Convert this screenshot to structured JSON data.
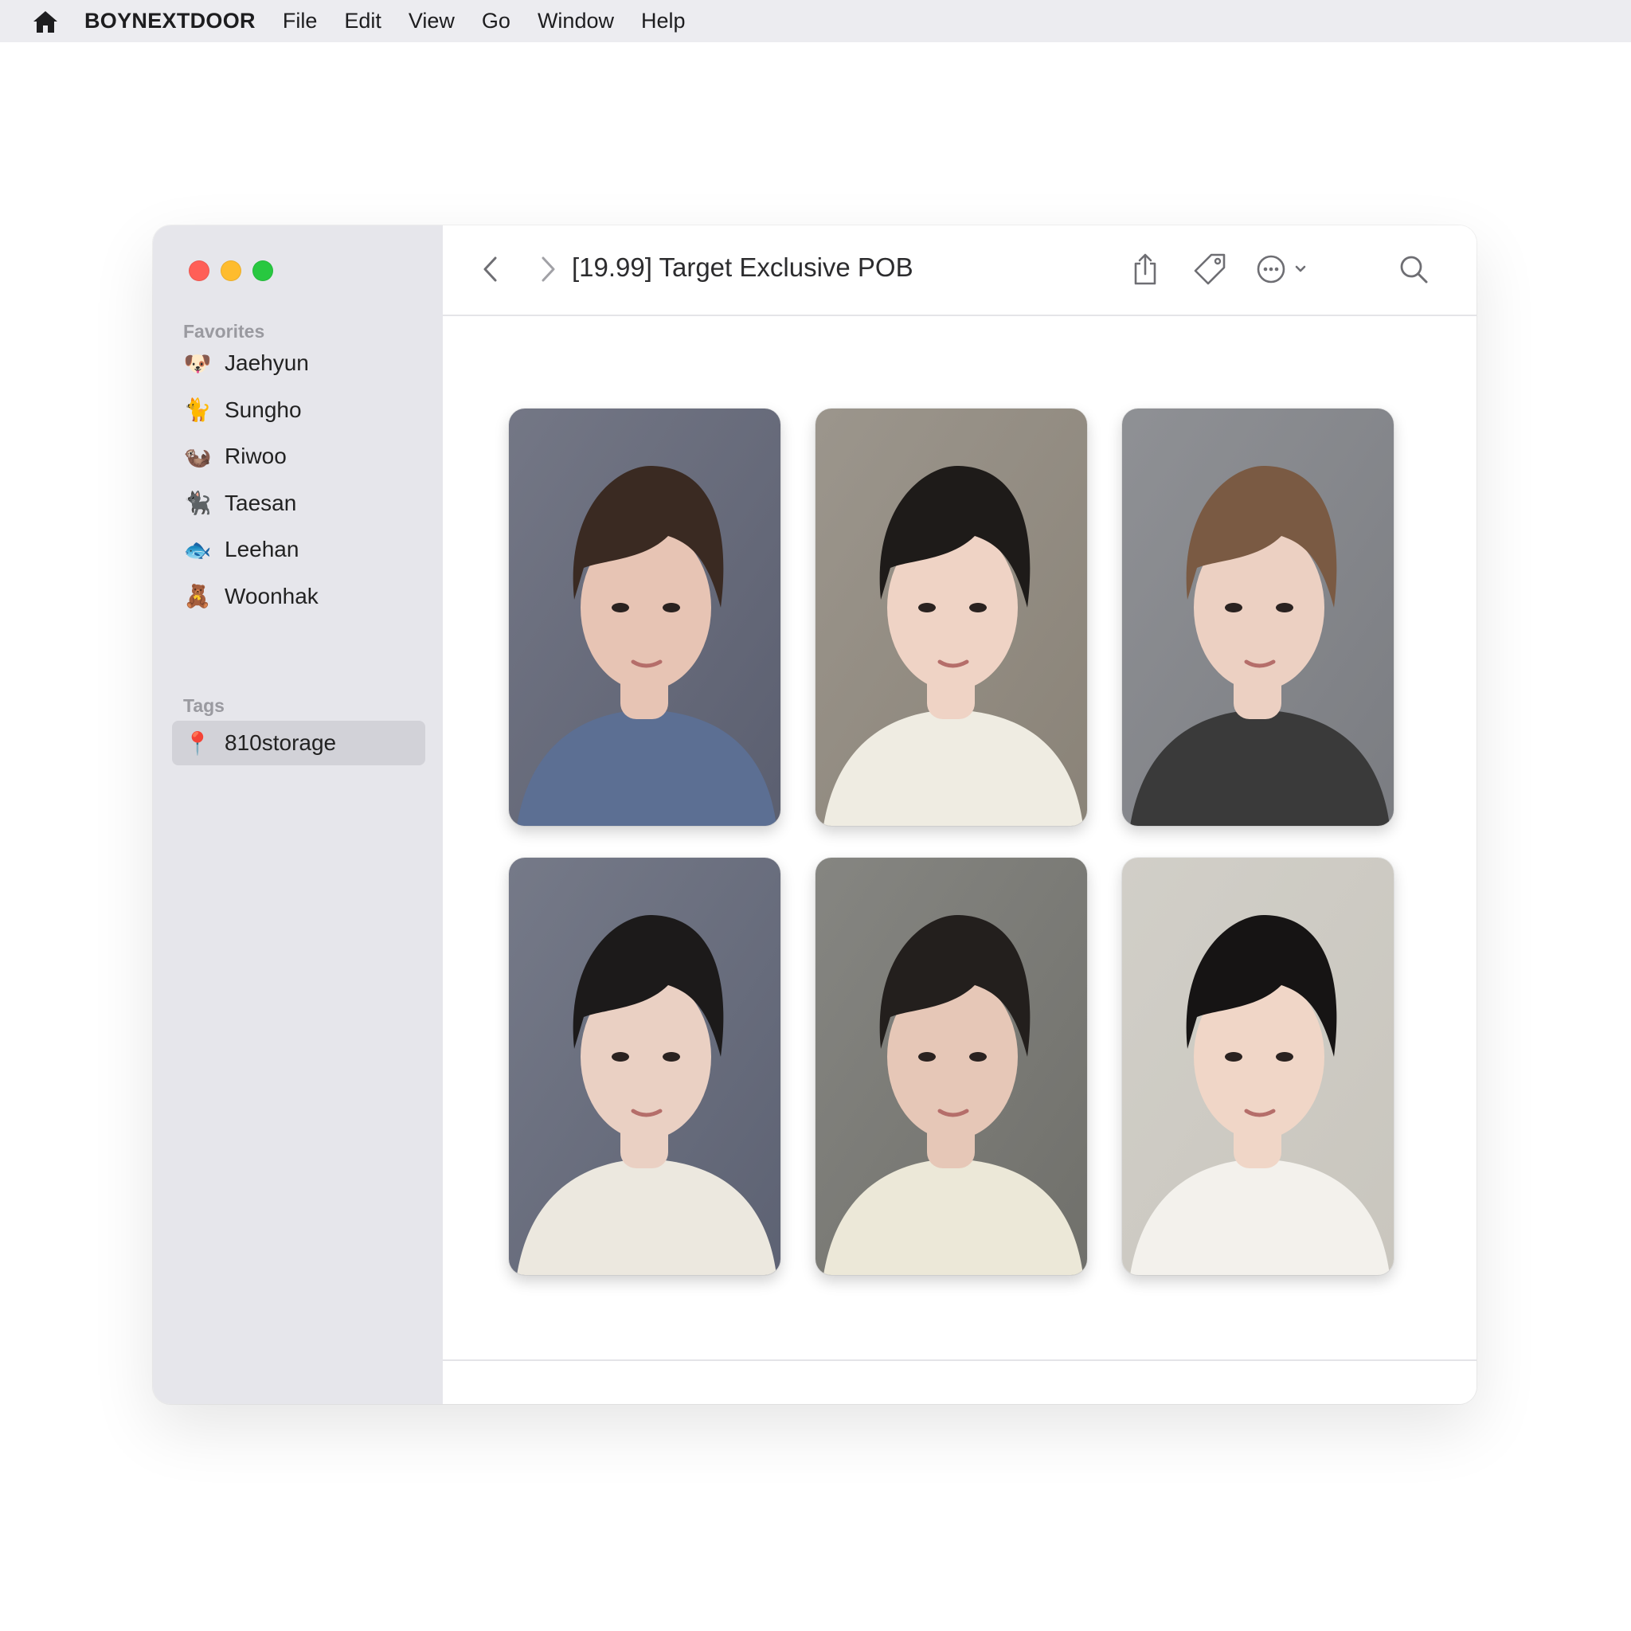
{
  "menubar": {
    "icon": "home-icon",
    "app_name": "BOYNEXTDOOR",
    "items": [
      "File",
      "Edit",
      "View",
      "Go",
      "Window",
      "Help"
    ]
  },
  "sidebar": {
    "favorites_title": "Favorites",
    "favorites": [
      {
        "emoji": "🐶",
        "label": "Jaehyun"
      },
      {
        "emoji": "🐈",
        "label": "Sungho"
      },
      {
        "emoji": "🦦",
        "label": "Riwoo"
      },
      {
        "emoji": "🐈‍⬛",
        "label": "Taesan"
      },
      {
        "emoji": "🐟",
        "label": "Leehan"
      },
      {
        "emoji": "🧸",
        "label": "Woonhak"
      }
    ],
    "tags_title": "Tags",
    "tags": [
      {
        "emoji": "📍",
        "label": "810storage"
      }
    ]
  },
  "toolbar": {
    "title": "[19.99] Target Exclusive POB",
    "icons": [
      "chevron-left-icon",
      "chevron-right-icon",
      "share-icon",
      "tag-icon",
      "more-icon",
      "search-icon"
    ]
  },
  "photos": [
    {
      "name": "photocard-1",
      "bg": "#5b5f70",
      "hair": "#3a2a22",
      "shirt": "#5c6f93",
      "skin": "#e7c4b4"
    },
    {
      "name": "photocard-2",
      "bg": "#8a8378",
      "hair": "#1e1b19",
      "shirt": "#efece2",
      "skin": "#efd3c5"
    },
    {
      "name": "photocard-3",
      "bg": "#7b7d82",
      "hair": "#7a5a43",
      "shirt": "#3a3a3a",
      "skin": "#ecd0c2"
    },
    {
      "name": "photocard-4",
      "bg": "#5d6273",
      "hair": "#1c1a1a",
      "shirt": "#ece8df",
      "skin": "#ead0c3"
    },
    {
      "name": "photocard-5",
      "bg": "#70706b",
      "hair": "#231f1d",
      "shirt": "#ece8d8",
      "skin": "#e6c7b7"
    },
    {
      "name": "photocard-6",
      "bg": "#c9c6be",
      "hair": "#161414",
      "shirt": "#f3f1ec",
      "skin": "#f0d6c7"
    }
  ]
}
